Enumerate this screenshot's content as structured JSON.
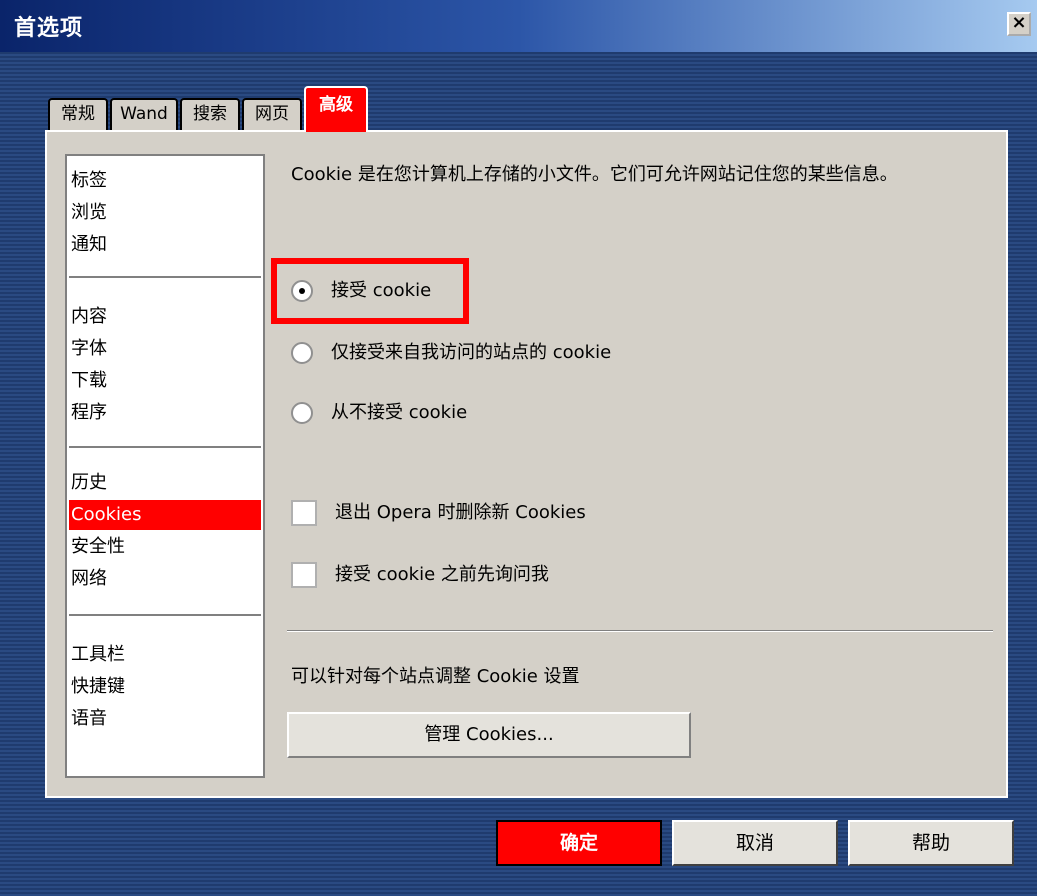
{
  "window": {
    "title": "首选项",
    "close_label": "×"
  },
  "tabs": [
    {
      "label": "常规"
    },
    {
      "label": "Wand"
    },
    {
      "label": "搜索"
    },
    {
      "label": "网页"
    },
    {
      "label": "高级",
      "active": true
    }
  ],
  "sidebar": {
    "groups": [
      [
        "标签",
        "浏览",
        "通知"
      ],
      [
        "内容",
        "字体",
        "下载",
        "程序"
      ],
      [
        "历史",
        "Cookies",
        "安全性",
        "网络"
      ],
      [
        "工具栏",
        "快捷键",
        "语音"
      ]
    ],
    "selected": "Cookies"
  },
  "cookies": {
    "description": "Cookie 是在您计算机上存储的小文件。它们可允许网站记住您的某些信息。",
    "radio_options": [
      {
        "label": "接受 cookie",
        "checked": true
      },
      {
        "label": "仅接受来自我访问的站点的 cookie",
        "checked": false
      },
      {
        "label": "从不接受 cookie",
        "checked": false
      }
    ],
    "checkboxes": [
      {
        "label": "退出 Opera 时删除新 Cookies",
        "checked": false
      },
      {
        "label": "接受 cookie 之前先询问我",
        "checked": false
      }
    ],
    "site_settings_text": "可以针对每个站点调整 Cookie 设置",
    "manage_button": "管理 Cookies..."
  },
  "footer": {
    "ok_label": "确定",
    "cancel_label": "取消",
    "help_label": "帮助"
  },
  "colors": {
    "accent": "#ff0000",
    "title_bar": "#0a246a",
    "panel": "#d4d0c8"
  }
}
